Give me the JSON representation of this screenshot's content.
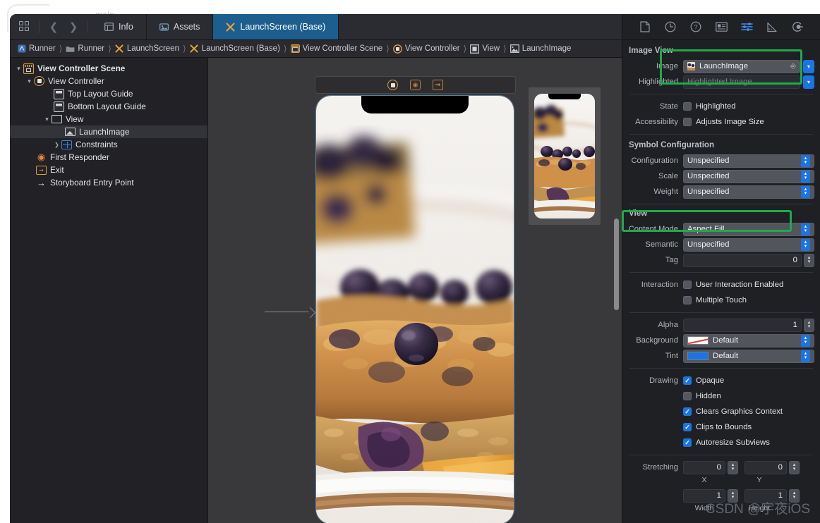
{
  "window": {
    "ghost_title": "main"
  },
  "tabbar": {
    "nav_icon": "grid-icon",
    "back_icon": "chevron-left-icon",
    "forward_icon": "chevron-right-icon",
    "tabs": [
      {
        "label": "Info",
        "icon": "table-icon",
        "active": false
      },
      {
        "label": "Assets",
        "icon": "assets-icon",
        "active": false
      },
      {
        "label": "LaunchScreen (Base)",
        "icon": "storyboard-x-icon",
        "active": true
      }
    ],
    "right_buttons": [
      {
        "name": "swap-editors-button",
        "icon": "swap-arrows-icon"
      },
      {
        "name": "minimap-button",
        "icon": "lines-icon"
      },
      {
        "name": "add-editor-button",
        "icon": "add-pane-icon"
      }
    ]
  },
  "breadcrumb": {
    "items": [
      {
        "label": "Runner",
        "icon": "app-icon"
      },
      {
        "label": "Runner",
        "icon": "folder-icon"
      },
      {
        "label": "LaunchScreen",
        "icon": "storyboard-x-icon"
      },
      {
        "label": "LaunchScreen (Base)",
        "icon": "storyboard-x-icon"
      },
      {
        "label": "View Controller Scene",
        "icon": "scene-icon"
      },
      {
        "label": "View Controller",
        "icon": "view-controller-icon"
      },
      {
        "label": "View",
        "icon": "view-icon"
      },
      {
        "label": "LaunchImage",
        "icon": "image-view-icon"
      }
    ],
    "warning_icon": "warning-triangle-icon",
    "prev_issue_icon": "chevron-left-icon",
    "next_issue_icon": "chevron-right-icon"
  },
  "navigator": {
    "nodes": [
      {
        "label": "View Controller Scene",
        "icon": "scene-icon",
        "indent": 0,
        "disclosure": "down",
        "selected": false
      },
      {
        "label": "View Controller",
        "icon": "view-controller-icon",
        "indent": 1,
        "disclosure": "down",
        "selected": false
      },
      {
        "label": "Top Layout Guide",
        "icon": "layout-guide-icon",
        "indent": 3,
        "disclosure": "none",
        "selected": false
      },
      {
        "label": "Bottom Layout Guide",
        "icon": "layout-guide-icon",
        "indent": 3,
        "disclosure": "none",
        "selected": false
      },
      {
        "label": "View",
        "icon": "view-icon",
        "indent": 2,
        "disclosure": "down",
        "selected": false
      },
      {
        "label": "LaunchImage",
        "icon": "image-view-icon",
        "indent": 4,
        "disclosure": "none",
        "selected": true
      },
      {
        "label": "Constraints",
        "icon": "constraints-icon",
        "indent": 3,
        "disclosure": "right",
        "selected": false
      },
      {
        "label": "First Responder",
        "icon": "first-responder-icon",
        "indent": 1,
        "disclosure": "none",
        "selected": false
      },
      {
        "label": "Exit",
        "icon": "exit-icon",
        "indent": 1,
        "disclosure": "none",
        "selected": false
      },
      {
        "label": "Storyboard Entry Point",
        "icon": "entry-arrow-icon",
        "indent": 1,
        "disclosure": "none",
        "selected": false
      }
    ]
  },
  "canvas": {
    "scene_dock": [
      {
        "name": "view-controller-dock-icon"
      },
      {
        "name": "first-responder-dock-icon"
      },
      {
        "name": "exit-dock-icon"
      }
    ],
    "entry_arrow": "storyboard-entry-arrow",
    "preview_thumbnail": "device-preview-thumbnail"
  },
  "inspector": {
    "tabs": [
      {
        "name": "file-inspector",
        "icon": "file-icon",
        "selected": false
      },
      {
        "name": "history-inspector",
        "icon": "clock-icon",
        "selected": false
      },
      {
        "name": "quick-help-inspector",
        "icon": "question-circle-icon",
        "selected": false
      },
      {
        "name": "identity-inspector",
        "icon": "identity-card-icon",
        "selected": false
      },
      {
        "name": "attributes-inspector",
        "icon": "sliders-icon",
        "selected": true
      },
      {
        "name": "size-inspector",
        "icon": "ruler-icon",
        "selected": false
      },
      {
        "name": "connections-inspector",
        "icon": "connections-icon",
        "selected": false
      }
    ],
    "image_view": {
      "title": "Image View",
      "image": {
        "label": "Image",
        "value": "LaunchImage",
        "icon": "asset-thumb-icon"
      },
      "highlighted": {
        "label": "Highlighted",
        "placeholder": "Highlighted Image"
      },
      "state": {
        "label": "State",
        "checkbox_label": "Highlighted",
        "checked": false
      },
      "accessibility": {
        "label": "Accessibility",
        "checkbox_label": "Adjusts Image Size",
        "checked": false
      }
    },
    "symbol_configuration": {
      "title": "Symbol Configuration",
      "rows": [
        {
          "label": "Configuration",
          "value": "Unspecified"
        },
        {
          "label": "Scale",
          "value": "Unspecified"
        },
        {
          "label": "Weight",
          "value": "Unspecified"
        }
      ]
    },
    "view": {
      "title": "View",
      "content_mode": {
        "label": "Content Mode",
        "value": "Aspect Fill"
      },
      "semantic": {
        "label": "Semantic",
        "value": "Unspecified"
      },
      "tag": {
        "label": "Tag",
        "value": "0"
      },
      "interaction": {
        "label": "Interaction",
        "items": [
          {
            "label": "User Interaction Enabled",
            "checked": false
          },
          {
            "label": "Multiple Touch",
            "checked": false
          }
        ]
      },
      "alpha": {
        "label": "Alpha",
        "value": "1"
      },
      "background": {
        "label": "Background",
        "value": "Default",
        "swatch": "#ffffff"
      },
      "tint": {
        "label": "Tint",
        "value": "Default",
        "swatch": "#1b74e4"
      },
      "drawing": {
        "label": "Drawing",
        "items": [
          {
            "label": "Opaque",
            "checked": true
          },
          {
            "label": "Hidden",
            "checked": false
          },
          {
            "label": "Clears Graphics Context",
            "checked": true
          },
          {
            "label": "Clips to Bounds",
            "checked": true
          },
          {
            "label": "Autoresize Subviews",
            "checked": true
          }
        ]
      },
      "stretching": {
        "label": "Stretching",
        "x": {
          "value": "0",
          "caption": "X"
        },
        "y": {
          "value": "0",
          "caption": "Y"
        },
        "width": {
          "value": "1",
          "caption": "Width"
        },
        "height": {
          "value": "1",
          "caption": "Height"
        }
      }
    }
  },
  "annotations": {
    "highlight_color": "#1faa4b",
    "boxes": [
      {
        "name": "image-field-highlight"
      },
      {
        "name": "content-mode-highlight"
      }
    ]
  },
  "watermark": {
    "text": "CSDN @宇夜iOS"
  }
}
